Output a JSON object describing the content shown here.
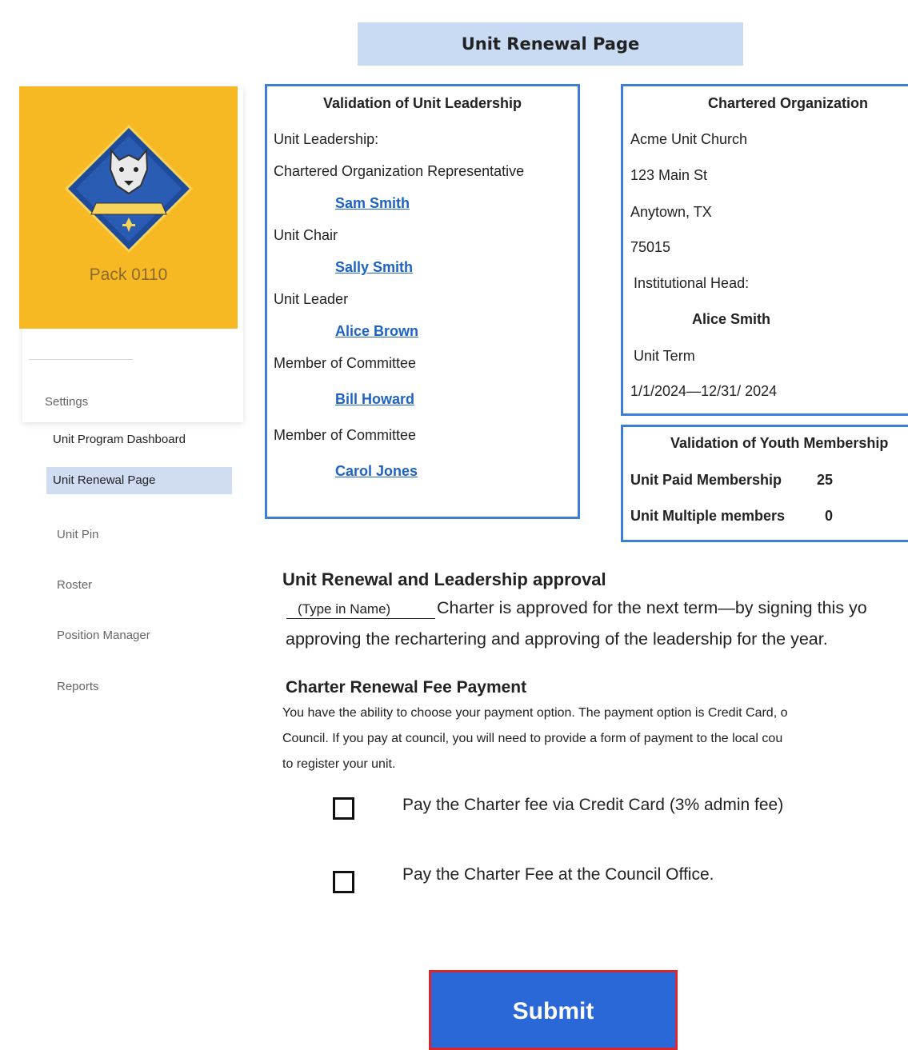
{
  "page": {
    "title": "Unit Renewal Page"
  },
  "sidebar": {
    "unit_name": "Pack 0110",
    "settings_label": "Settings",
    "items": [
      {
        "label": "Unit Program Dashboard",
        "active": false
      },
      {
        "label": "Unit Renewal Page",
        "active": true
      },
      {
        "label": "Unit Pin",
        "active": false
      },
      {
        "label": "Roster",
        "active": false
      },
      {
        "label": "Position Manager",
        "active": false
      },
      {
        "label": "Reports",
        "active": false
      }
    ]
  },
  "leadership": {
    "title": "Validation of Unit Leadership",
    "intro": "Unit Leadership:",
    "roles": [
      {
        "role": "Chartered Organization Representative",
        "name": "Sam Smith"
      },
      {
        "role": "Unit Chair",
        "name": "Sally Smith"
      },
      {
        "role": "Unit Leader",
        "name": "Alice Brown"
      },
      {
        "role": "Member of Committee",
        "name": "Bill Howard"
      },
      {
        "role": "Member of Committee",
        "name": "Carol Jones"
      }
    ]
  },
  "chartered_org": {
    "title": "Chartered Organization",
    "name": "Acme Unit Church",
    "street": "123 Main St",
    "city": "Anytown, TX",
    "zip": "75015",
    "head_label": "Institutional Head:",
    "head_name": "Alice Smith",
    "term_label": "Unit Term",
    "term": "1/1/2024—12/31/ 2024"
  },
  "youth": {
    "title": "Validation of Youth Membership",
    "paid_label": "Unit Paid Membership",
    "paid_value": "25",
    "multiple_label": "Unit Multiple members",
    "multiple_value": "0"
  },
  "approval": {
    "title": "Unit Renewal and Leadership approval",
    "name_placeholder": "(Type in Name)",
    "line1": "Charter is approved for the next term—by signing this yo",
    "line2": "approving the rechartering and  approving of the leadership for the year."
  },
  "fee": {
    "title": "Charter Renewal Fee Payment",
    "line1": "You have the ability to choose your payment option. The payment option is Credit Card, o",
    "line2": "Council. If you pay at council, you will need to provide a form of payment to the local cou",
    "line3": "to register your unit.",
    "options": [
      {
        "label": "Pay the Charter fee via Credit Card (3% admin fee)",
        "checked": false
      },
      {
        "label": "Pay the Charter Fee at the Council Office.",
        "checked": false
      }
    ]
  },
  "submit_label": "Submit",
  "colors": {
    "header_bg": "#c9daf3",
    "box_border": "#3d7fd6",
    "link": "#1d62c4",
    "button": "#2a68d8",
    "button_border": "#d8262c",
    "logo_bg": "#f6b923"
  }
}
